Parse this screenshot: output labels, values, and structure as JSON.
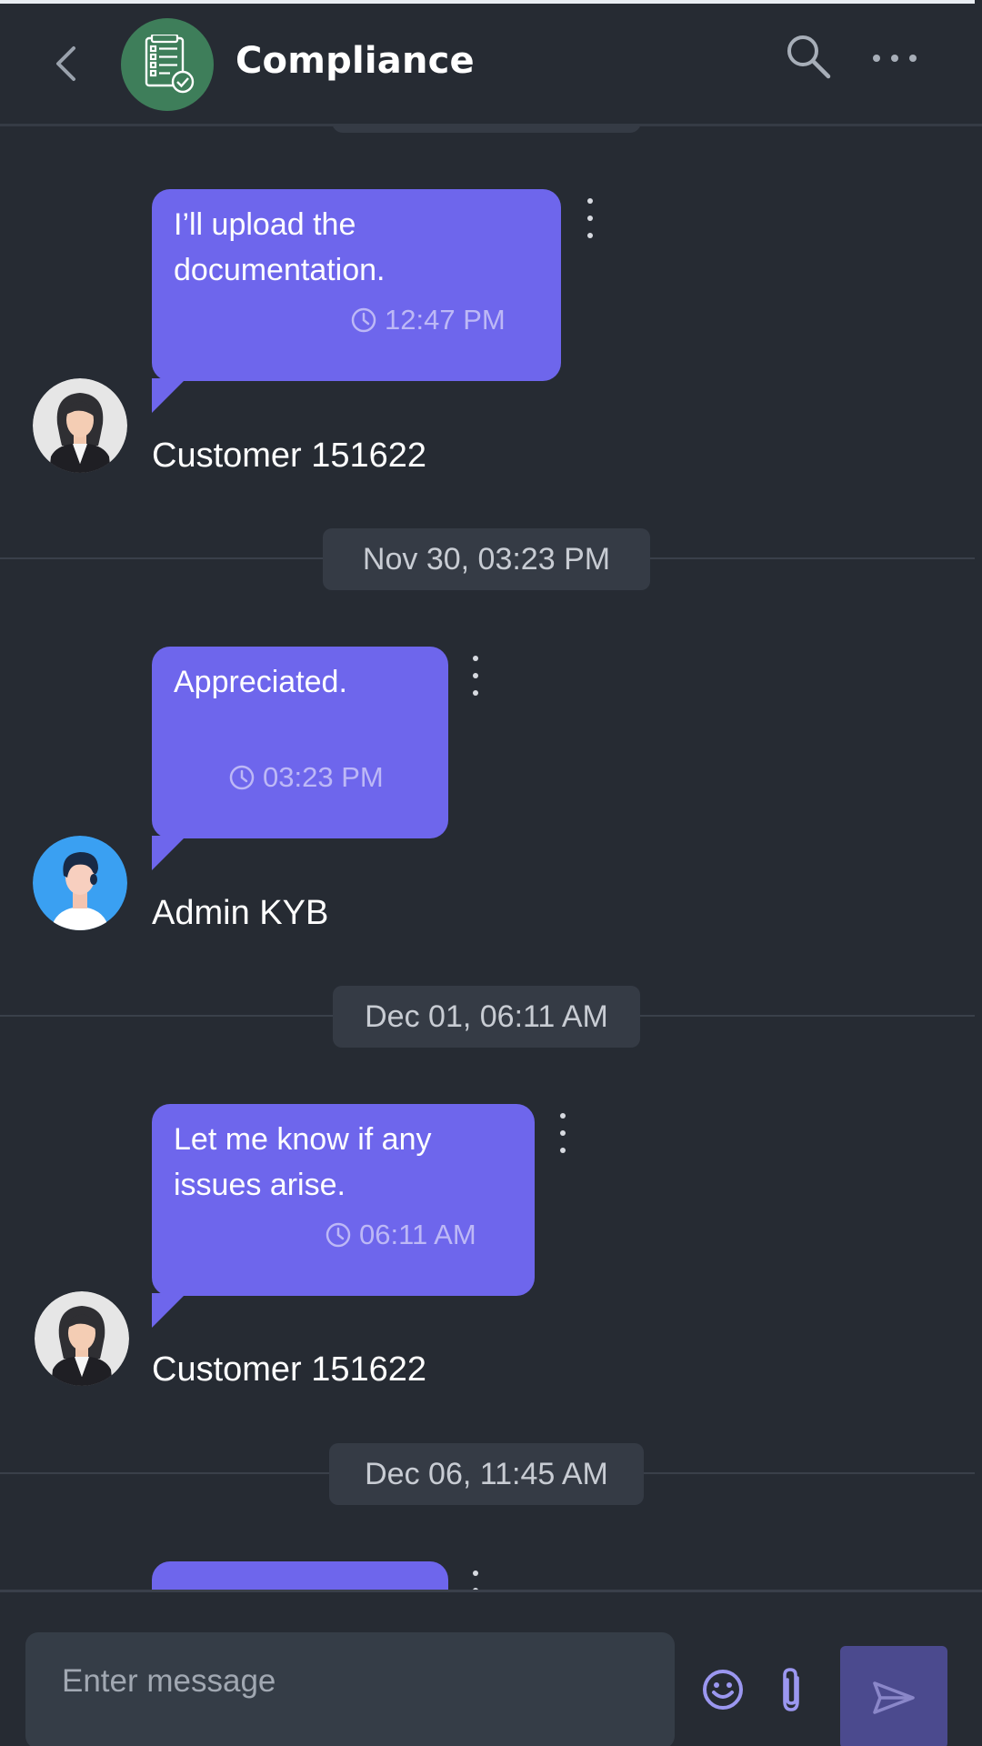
{
  "header": {
    "title": "Compliance",
    "back_icon": "chevron-left-icon",
    "avatar_icon": "checklist-document-icon",
    "search_icon": "search-icon",
    "more_icon": "more-horizontal-icon"
  },
  "messages": [
    {
      "text_line1": "I’ll upload the",
      "text_line2": "documentation.",
      "time": "12:47 PM",
      "sender": "Customer 151622"
    },
    {
      "date": "Nov 30, 03:23 PM",
      "text_line1": "Appreciated.",
      "time": "03:23 PM",
      "sender": "Admin KYB"
    },
    {
      "date": "Dec 01, 06:11 AM",
      "text_line1": "Let me know if any",
      "text_line2": "issues arise.",
      "time": "06:11 AM",
      "sender": "Customer 151622"
    },
    {
      "date": "Dec 06, 11:45 AM"
    }
  ],
  "composer": {
    "placeholder": "Enter message",
    "emoji_icon": "emoji-icon",
    "attach_icon": "paperclip-icon",
    "send_icon": "send-icon"
  },
  "colors": {
    "background": "#262b33",
    "bubble": "#6e66ec",
    "date_pill": "#353b45",
    "send_button": "#4b4a8e",
    "header_avatar": "#3e7e5a"
  }
}
